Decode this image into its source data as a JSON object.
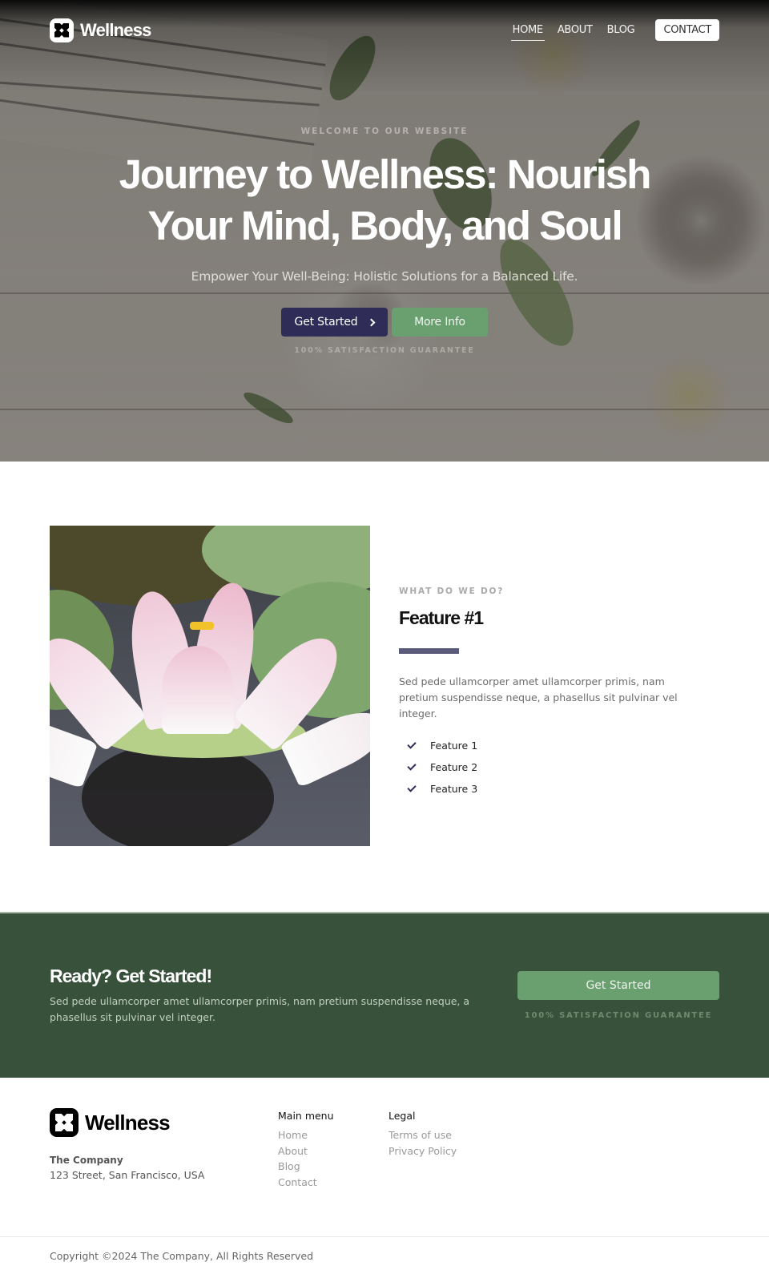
{
  "brand": {
    "name": "Wellness",
    "logo_icon": "flower-logo-icon"
  },
  "nav": {
    "links": [
      {
        "label": "HOME",
        "active": true
      },
      {
        "label": "ABOUT",
        "active": false
      },
      {
        "label": "BLOG",
        "active": false
      }
    ],
    "contact_label": "CONTACT"
  },
  "hero": {
    "eyebrow": "WELCOME TO OUR WEBSITE",
    "title": "Journey to Wellness: Nourish Your Mind, Body, and Soul",
    "subtitle": "Empower Your Well-Being: Holistic Solutions for a Balanced Life.",
    "primary_button": "Get Started",
    "primary_button_icon": "chevron-right-icon",
    "secondary_button": "More Info",
    "guarantee": "100% SATISFACTION GUARANTEE"
  },
  "feature": {
    "image_subject": "pink water lily on dark water with lily pads",
    "eyebrow": "WHAT DO WE DO?",
    "title": "Feature #1",
    "description": "Sed pede ullamcorper amet ullamcorper primis, nam pretium suspendisse neque, a phasellus sit pulvinar vel integer.",
    "items": [
      "Feature 1",
      "Feature 2",
      "Feature 3"
    ]
  },
  "cta": {
    "title": "Ready? Get Started!",
    "description": "Sed pede ullamcorper amet ullamcorper primis, nam pretium suspendisse neque, a phasellus sit pulvinar vel integer.",
    "button": "Get Started",
    "guarantee": "100% SATISFACTION GUARANTEE"
  },
  "footer": {
    "company": "The Company",
    "address": "123 Street, San Francisco, USA",
    "columns": [
      {
        "title": "Main menu",
        "links": [
          "Home",
          "About",
          "Blog",
          "Contact"
        ]
      },
      {
        "title": "Legal",
        "links": [
          "Terms of use",
          "Privacy Policy"
        ]
      }
    ],
    "copyright": "Copyright ©2024 The Company, All Rights Reserved"
  },
  "colors": {
    "primary": "#2f2d58",
    "accent_green": "#6a9f70",
    "cta_background": "#37513a",
    "feature_bar": "#5c5a7a"
  }
}
